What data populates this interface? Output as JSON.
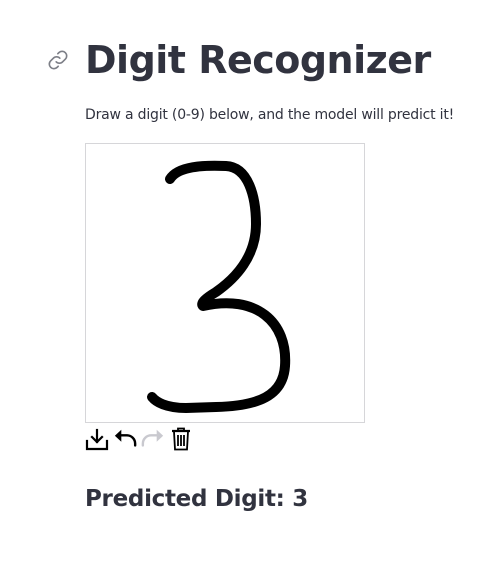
{
  "page": {
    "title": "Digit Recognizer",
    "description": "Draw a digit (0-9) below, and the model will predict it!",
    "anchor_icon": "link-icon"
  },
  "canvas": {
    "background": "#ffffff",
    "stroke_color": "#000000",
    "drawn_content": "3"
  },
  "toolbar": {
    "items": [
      {
        "icon": "download-icon",
        "enabled": true
      },
      {
        "icon": "undo-icon",
        "enabled": true
      },
      {
        "icon": "redo-icon",
        "enabled": false
      },
      {
        "icon": "trash-icon",
        "enabled": true
      }
    ]
  },
  "result": {
    "text": "Predicted Digit: 3"
  },
  "colors": {
    "text": "#31333f",
    "disabled_icon": "#c9c9cf",
    "icon": "#000000",
    "canvas_border": "#d6d6d9"
  }
}
